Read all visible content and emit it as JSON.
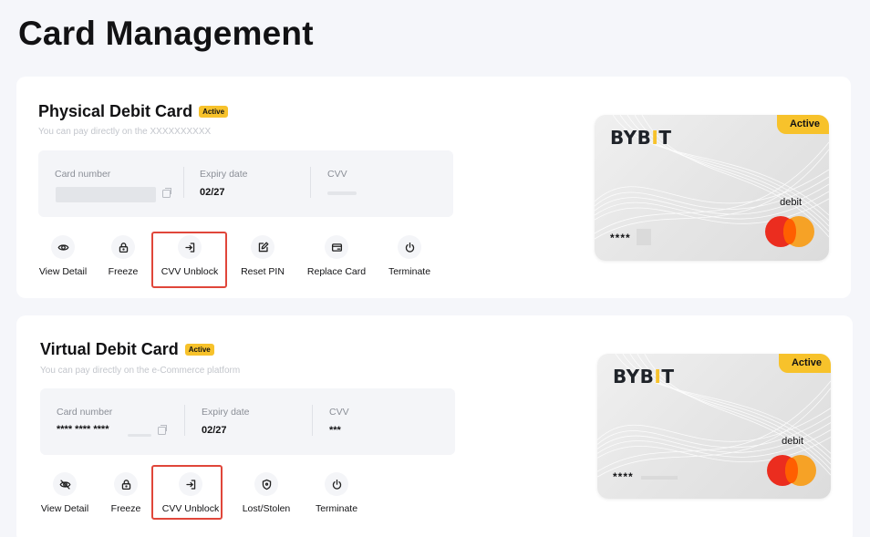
{
  "page": {
    "title": "Card Management"
  },
  "colors": {
    "accent": "#f7c22b",
    "highlight": "#e0463a",
    "mastercard_red": "#eb2d1f",
    "mastercard_orange": "#f79e1b"
  },
  "physical": {
    "title": "Physical Debit Card",
    "badge": "Active",
    "subtitle": "You can pay directly on the XXXXXXXXXX",
    "card_number_label": "Card number",
    "expiry_label": "Expiry date",
    "expiry_value": "02/27",
    "cvv_label": "CVV",
    "actions": [
      {
        "label": "View Detail",
        "icon": "eye-icon"
      },
      {
        "label": "Freeze",
        "icon": "lock-icon"
      },
      {
        "label": "CVV Unblock",
        "icon": "unblock-icon"
      },
      {
        "label": "Reset PIN",
        "icon": "edit-icon"
      },
      {
        "label": "Replace Card",
        "icon": "card-icon"
      },
      {
        "label": "Terminate",
        "icon": "power-icon"
      }
    ],
    "card_visual": {
      "brand_left": "BYB",
      "brand_bar": "I",
      "brand_right": "T",
      "status": "Active",
      "type": "debit",
      "number": "****"
    }
  },
  "virtual": {
    "title": "Virtual Debit Card",
    "badge": "Active",
    "subtitle": "You can pay directly on the e-Commerce platform",
    "card_number_label": "Card number",
    "card_number_value": "**** **** ****",
    "expiry_label": "Expiry date",
    "expiry_value": "02/27",
    "cvv_label": "CVV",
    "cvv_value": "***",
    "actions": [
      {
        "label": "View Detail",
        "icon": "eye-off-icon"
      },
      {
        "label": "Freeze",
        "icon": "lock-icon"
      },
      {
        "label": "CVV Unblock",
        "icon": "unblock-icon"
      },
      {
        "label": "Lost/Stolen",
        "icon": "shield-icon"
      },
      {
        "label": "Terminate",
        "icon": "power-icon"
      }
    ],
    "card_visual": {
      "brand_left": "BYB",
      "brand_bar": "I",
      "brand_right": "T",
      "status": "Active",
      "type": "debit",
      "number": "****"
    }
  }
}
